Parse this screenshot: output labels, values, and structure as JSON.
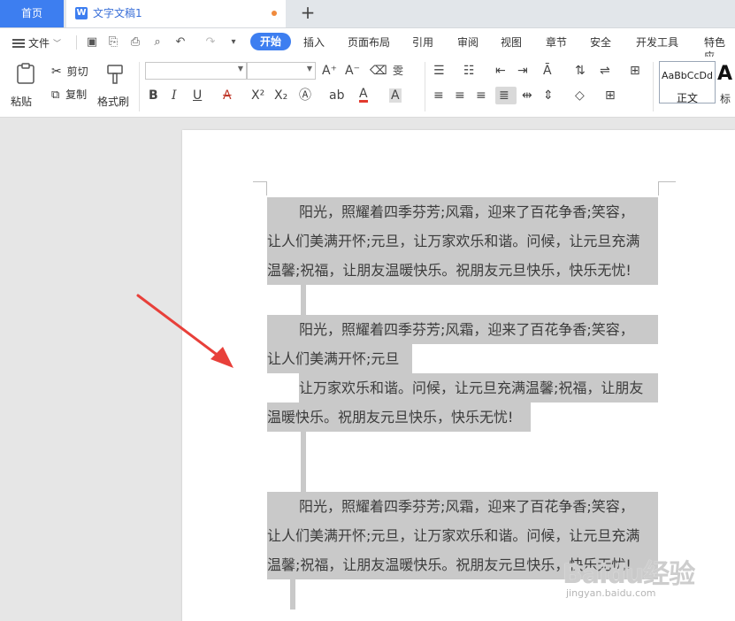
{
  "tabs": {
    "home": "首页",
    "doc_title": "文字文稿1",
    "doc_icon": "W",
    "add": "+"
  },
  "menu": {
    "file": "文件",
    "items": [
      "开始",
      "插入",
      "页面布局",
      "引用",
      "审阅",
      "视图",
      "章节",
      "安全",
      "开发工具",
      "特色应"
    ]
  },
  "ribbon": {
    "paste": "粘贴",
    "cut": "剪切",
    "copy": "复制",
    "format_painter": "格式刷",
    "style_sample": "AaBbCcDd",
    "style_label": "正文",
    "style_next": "A",
    "style_next_label": "标"
  },
  "document": {
    "p1": [
      "阳光，照耀着四季芬芳;风霜，迎来了百花争香;笑容，",
      "让人们美满开怀;元旦，让万家欢乐和谐。问候，让元旦充满",
      "温馨;祝福，让朋友温暖快乐。祝朋友元旦快乐，快乐无忧!"
    ],
    "p2": [
      "阳光，照耀着四季芬芳;风霜，迎来了百花争香;笑容，",
      "让人们美满开怀;元旦"
    ],
    "p3": [
      "让万家欢乐和谐。问候，让元旦充满温馨;祝福，让朋友",
      "温暖快乐。祝朋友元旦快乐，快乐无忧!"
    ],
    "p4": [
      "阳光，照耀着四季芬芳;风霜，迎来了百花争香;笑容，",
      "让人们美满开怀;元旦，让万家欢乐和谐。问候，让元旦充满",
      "温馨;祝福，让朋友温暖快乐。祝朋友元旦快乐，快乐无忧!"
    ]
  },
  "watermark": {
    "main": "Baidu经验",
    "sub": "jingyan.baidu.com"
  },
  "colors": {
    "accent": "#3d7ef0",
    "highlight": "#c9c9c9",
    "arrow": "#e8403a"
  }
}
